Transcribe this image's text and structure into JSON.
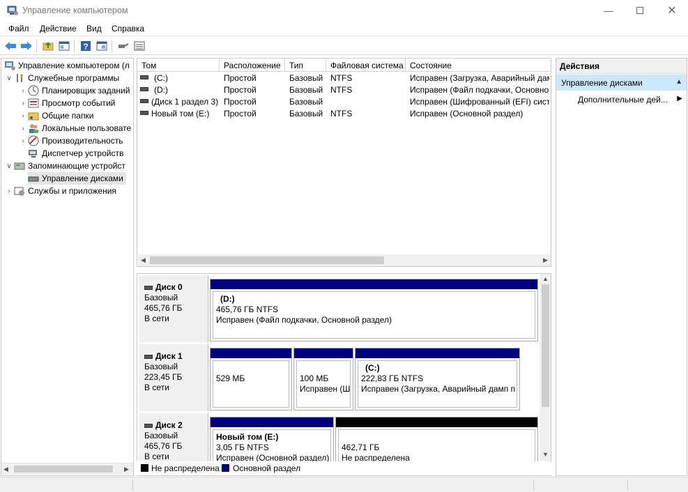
{
  "window": {
    "title": "Управление компьютером"
  },
  "menu": [
    "Файл",
    "Действие",
    "Вид",
    "Справка"
  ],
  "tree": {
    "root": "Управление компьютером (л",
    "utilities": "Служебные программы",
    "task_scheduler": "Планировщик заданий",
    "event_viewer": "Просмотр событий",
    "shared_folders": "Общие папки",
    "local_users": "Локальные пользовате",
    "performance": "Производительность",
    "device_manager": "Диспетчер устройств",
    "storage": "Запоминающие устройст",
    "disk_management": "Управление дисками",
    "services": "Службы и приложения"
  },
  "volume_columns": [
    "Том",
    "Расположение",
    "Тип",
    "Файловая система",
    "Состояние"
  ],
  "volumes": [
    {
      "name": "(C:)",
      "layout": "Простой",
      "type": "Базовый",
      "fs": "NTFS",
      "status": "Исправен (Загрузка, Аварийный дам"
    },
    {
      "name": "(D:)",
      "layout": "Простой",
      "type": "Базовый",
      "fs": "NTFS",
      "status": "Исправен (Файл подкачки, Основной"
    },
    {
      "name": "(Диск 1 раздел 3)",
      "layout": "Простой",
      "type": "Базовый",
      "fs": "",
      "status": "Исправен (Шифрованный (EFI) систе"
    },
    {
      "name": "Новый том (E:)",
      "layout": "Простой",
      "type": "Базовый",
      "fs": "NTFS",
      "status": "Исправен (Основной раздел)"
    }
  ],
  "disks": [
    {
      "name": "Диск 0",
      "kind": "Базовый",
      "size": "465,76 ГБ",
      "state": "В сети",
      "parts": [
        {
          "title": "(D:)",
          "line1": "465,76 ГБ NTFS",
          "line2": "Исправен (Файл подкачки, Основной раздел)"
        }
      ]
    },
    {
      "name": "Диск 1",
      "kind": "Базовый",
      "size": "223,45 ГБ",
      "state": "В сети",
      "parts": [
        {
          "title": "",
          "line1": "529 МБ",
          "line2": ""
        },
        {
          "title": "",
          "line1": "100 МБ",
          "line2": "Исправен (Ш"
        },
        {
          "title": "(C:)",
          "line1": "222,83 ГБ NTFS",
          "line2": "Исправен (Загрузка, Аварийный дамп п"
        }
      ]
    },
    {
      "name": "Диск 2",
      "kind": "Базовый",
      "size": "465,76 ГБ",
      "state": "В сети",
      "parts": [
        {
          "title": "Новый том  (E:)",
          "line1": "3,05 ГБ NTFS",
          "line2": "Исправен (Основной раздел)"
        },
        {
          "title": "",
          "line1": "462,71 ГБ",
          "line2": "Не распределена"
        }
      ]
    }
  ],
  "legend": {
    "unallocated": "Не распределена",
    "primary": "Основной раздел"
  },
  "actions": {
    "header": "Действия",
    "group": "Управление дисками",
    "more": "Дополнительные дей..."
  },
  "colors": {
    "primary": "#00007f",
    "unallocated": "#000000",
    "selection": "#cce8ff"
  }
}
